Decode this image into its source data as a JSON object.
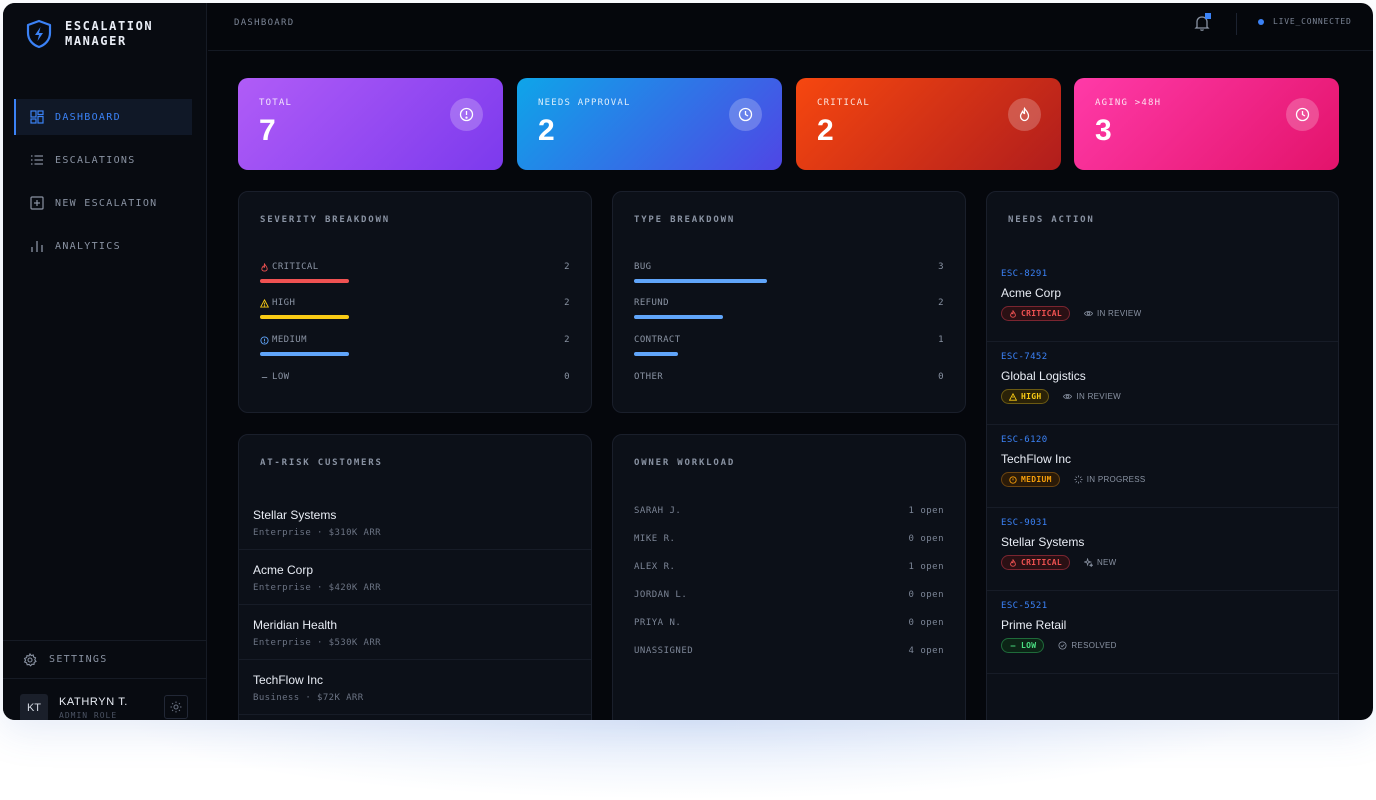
{
  "app": {
    "title_line1": "ESCALATION",
    "title_line2": "MANAGER"
  },
  "sidebar": {
    "items": [
      {
        "label": "DASHBOARD",
        "icon": "dashboard-icon",
        "active": true
      },
      {
        "label": "ESCALATIONS",
        "icon": "list-icon",
        "active": false
      },
      {
        "label": "NEW ESCALATION",
        "icon": "plus-square-icon",
        "active": false
      },
      {
        "label": "ANALYTICS",
        "icon": "bar-chart-icon",
        "active": false
      }
    ],
    "settings_label": "SETTINGS",
    "user": {
      "initials": "KT",
      "name": "KATHRYN T.",
      "role": "ADMIN ROLE"
    }
  },
  "topbar": {
    "breadcrumb": "DASHBOARD",
    "status": "LIVE_CONNECTED"
  },
  "stats": [
    {
      "label": "TOTAL",
      "value": "7",
      "icon": "alert-circle-icon",
      "gradient": [
        "#a855f7",
        "#7c3aed"
      ]
    },
    {
      "label": "NEEDS APPROVAL",
      "value": "2",
      "icon": "clock-icon",
      "gradient": [
        "#0ea5e9",
        "#4f46e5"
      ]
    },
    {
      "label": "CRITICAL",
      "value": "2",
      "icon": "flame-icon",
      "gradient": [
        "#f0440e",
        "#b91c1c"
      ]
    },
    {
      "label": "AGING >48H",
      "value": "3",
      "icon": "clock-icon",
      "gradient": [
        "#ff3ea5",
        "#e6176f"
      ]
    }
  ],
  "severity": {
    "title": "SEVERITY BREAKDOWN",
    "rows": [
      {
        "label": "CRITICAL",
        "count": "2",
        "color": "#f05252",
        "fraction": 0.286,
        "icon": "flame-icon"
      },
      {
        "label": "HIGH",
        "count": "2",
        "color": "#facc15",
        "fraction": 0.286,
        "icon": "warning-icon"
      },
      {
        "label": "MEDIUM",
        "count": "2",
        "color": "#60a5fa",
        "fraction": 0.286,
        "icon": "info-circle-icon"
      },
      {
        "label": "LOW",
        "count": "0",
        "color": "#4ade80",
        "fraction": 0,
        "icon": "minus-icon"
      }
    ]
  },
  "types": {
    "title": "TYPE BREAKDOWN",
    "rows": [
      {
        "label": "BUG",
        "count": "3",
        "color": "#60a5fa",
        "fraction": 0.429
      },
      {
        "label": "REFUND",
        "count": "2",
        "color": "#60a5fa",
        "fraction": 0.286
      },
      {
        "label": "CONTRACT",
        "count": "1",
        "color": "#60a5fa",
        "fraction": 0.143
      },
      {
        "label": "OTHER",
        "count": "0",
        "color": "#60a5fa",
        "fraction": 0
      }
    ]
  },
  "at_risk": {
    "title": "AT-RISK CUSTOMERS",
    "rows": [
      {
        "name": "Stellar Systems",
        "meta": "Enterprise · $310K ARR"
      },
      {
        "name": "Acme Corp",
        "meta": "Enterprise · $420K ARR"
      },
      {
        "name": "Meridian Health",
        "meta": "Enterprise · $530K ARR"
      },
      {
        "name": "TechFlow Inc",
        "meta": "Business · $72K ARR"
      }
    ]
  },
  "workload": {
    "title": "OWNER WORKLOAD",
    "rows": [
      {
        "name": "SARAH J.",
        "value": "1 open"
      },
      {
        "name": "MIKE R.",
        "value": "0 open"
      },
      {
        "name": "ALEX R.",
        "value": "1 open"
      },
      {
        "name": "JORDAN L.",
        "value": "0 open"
      },
      {
        "name": "PRIYA N.",
        "value": "0 open"
      },
      {
        "name": "UNASSIGNED",
        "value": "4 open"
      }
    ]
  },
  "needs_action": {
    "title": "NEEDS ACTION",
    "rows": [
      {
        "id": "ESC-8291",
        "name": "Acme Corp",
        "severity": "CRITICAL",
        "sev_color": "#f05252",
        "sev_bg": "#2a1014",
        "sev_icon": "flame-icon",
        "status": "IN REVIEW",
        "status_icon": "eye-icon"
      },
      {
        "id": "ESC-7452",
        "name": "Global Logistics",
        "severity": "HIGH",
        "sev_color": "#facc15",
        "sev_bg": "#2a2208",
        "sev_icon": "warning-icon",
        "status": "IN REVIEW",
        "status_icon": "eye-icon"
      },
      {
        "id": "ESC-6120",
        "name": "TechFlow Inc",
        "severity": "MEDIUM",
        "sev_color": "#f59e0b",
        "sev_bg": "#2a1a08",
        "sev_icon": "info-circle-icon",
        "status": "IN PROGRESS",
        "status_icon": "spinner-icon"
      },
      {
        "id": "ESC-9031",
        "name": "Stellar Systems",
        "severity": "CRITICAL",
        "sev_color": "#f05252",
        "sev_bg": "#2a1014",
        "sev_icon": "flame-icon",
        "status": "NEW",
        "status_icon": "sparkle-icon"
      },
      {
        "id": "ESC-5521",
        "name": "Prime Retail",
        "severity": "LOW",
        "sev_color": "#4ade80",
        "sev_bg": "#0c2416",
        "sev_icon": "minus-icon",
        "status": "RESOLVED",
        "status_icon": "check-circle-icon"
      }
    ]
  }
}
